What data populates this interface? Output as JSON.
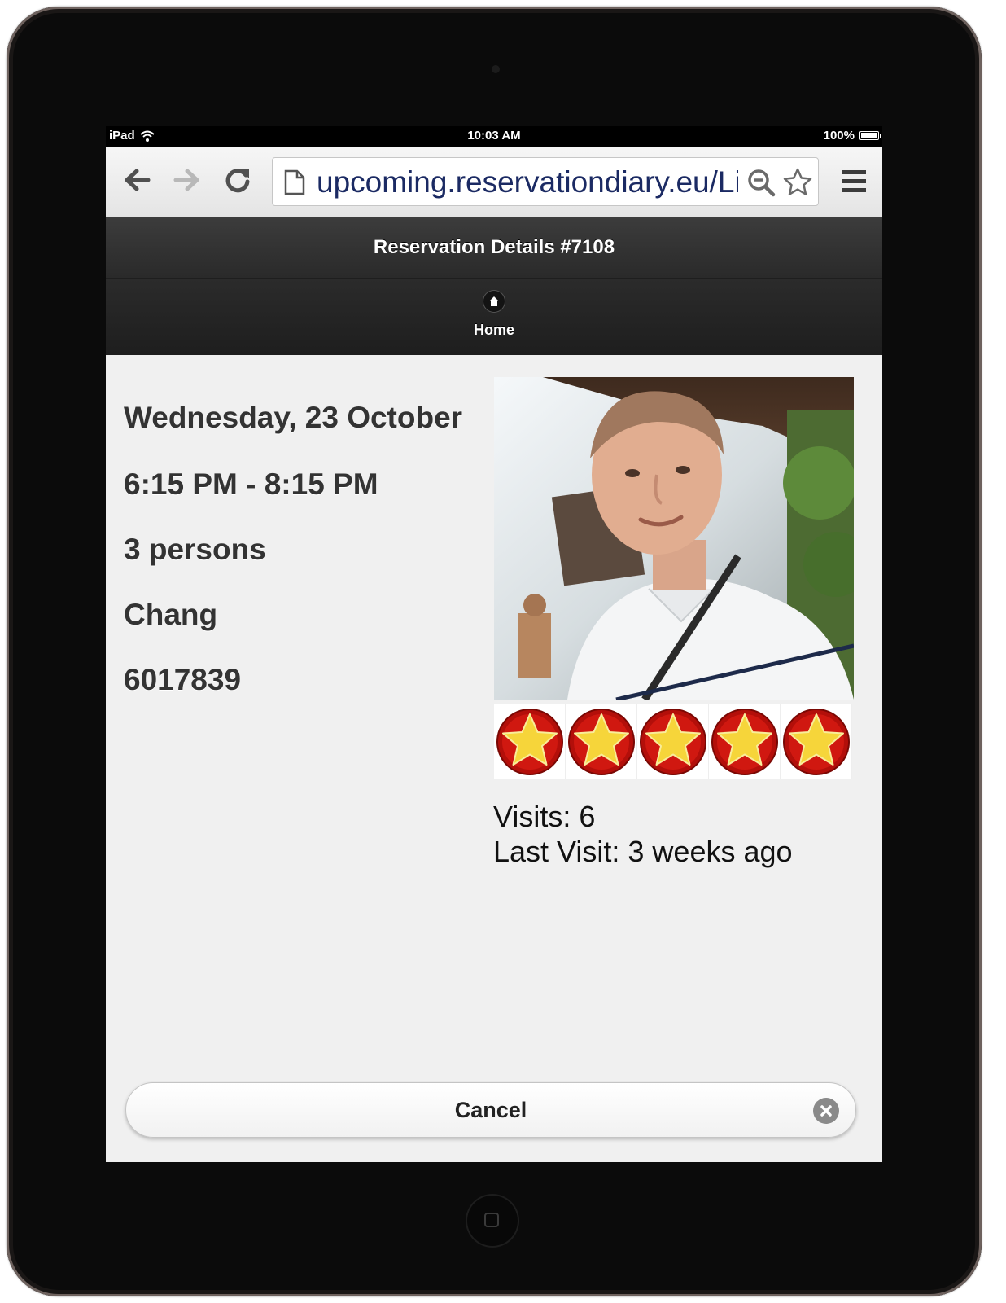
{
  "statusbar": {
    "device": "iPad",
    "time": "10:03 AM",
    "battery": "100%"
  },
  "browser": {
    "url": "upcoming.reservationdiary.eu/List/"
  },
  "header": {
    "title": "Reservation Details #7108"
  },
  "nav": {
    "home_label": "Home"
  },
  "reservation": {
    "date": "Wednesday, 23 October",
    "time": "6:15 PM - 8:15 PM",
    "persons": "3 persons",
    "name": "Chang",
    "phone": "6017839"
  },
  "guest": {
    "rating": 5,
    "rating_max": 5,
    "visits": "Visits: 6",
    "last_visit": "Last Visit: 3 weeks ago"
  },
  "footer": {
    "cancel_label": "Cancel"
  },
  "colors": {
    "header_bg": "#2f2f2f",
    "content_bg": "#f0f0f0",
    "star_fill": "#f6d53a",
    "star_badge": "#b30f0a"
  }
}
